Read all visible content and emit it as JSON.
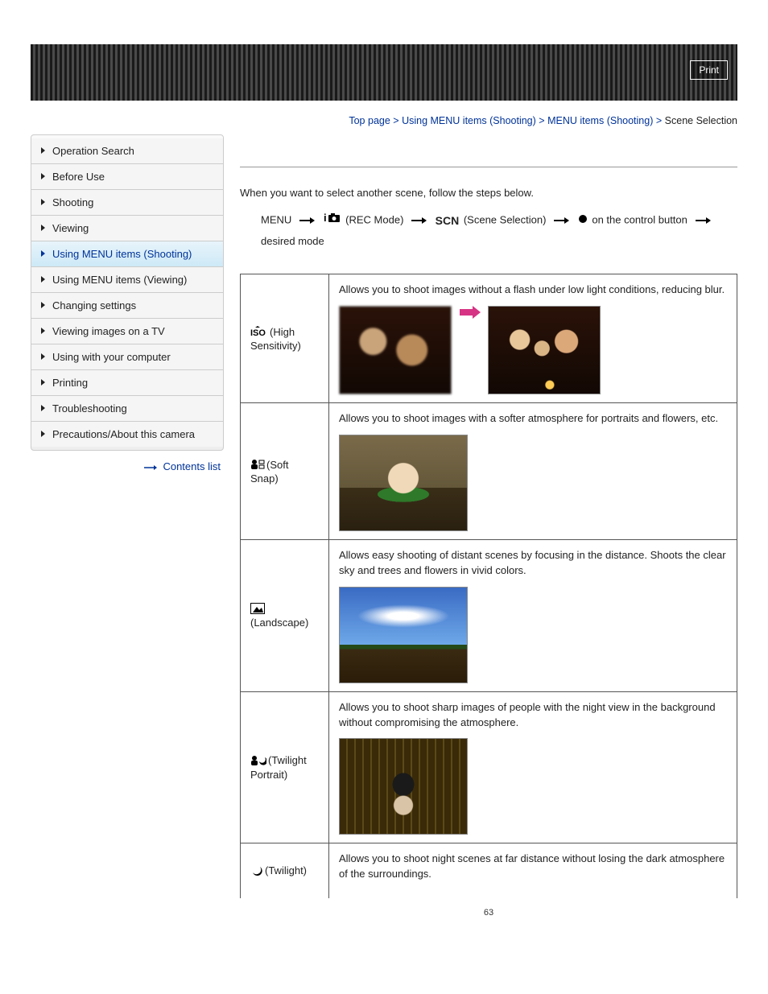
{
  "print_label": "Print",
  "breadcrumb": {
    "top": "Top page",
    "l1": "Using MENU items (Shooting)",
    "l2": "MENU items (Shooting)",
    "current": "Scene Selection",
    "sep": ">"
  },
  "sidebar": {
    "items": [
      {
        "label": "Operation Search"
      },
      {
        "label": "Before Use"
      },
      {
        "label": "Shooting"
      },
      {
        "label": "Viewing"
      },
      {
        "label": "Using MENU items (Shooting)",
        "active": true
      },
      {
        "label": "Using MENU items (Viewing)"
      },
      {
        "label": "Changing settings"
      },
      {
        "label": "Viewing images on a TV"
      },
      {
        "label": "Using with your computer"
      },
      {
        "label": "Printing"
      },
      {
        "label": "Troubleshooting"
      },
      {
        "label": "Precautions/About this camera"
      }
    ],
    "contents_link": "Contents list"
  },
  "intro": "When you want to select another scene, follow the steps below.",
  "steps": {
    "menu": "MENU",
    "rec_mode": "(REC Mode)",
    "scene_sel": "(Scene Selection)",
    "ctrl_btn": "on the control button",
    "desired": "desired mode",
    "scn_text": "SCN"
  },
  "rows": [
    {
      "name": "(High Sensitivity)",
      "icon": "iso-icon",
      "desc": "Allows you to shoot images without a flash under low light conditions, reducing blur."
    },
    {
      "name": "(Soft Snap)",
      "icon": "softsnap-icon",
      "desc": "Allows you to shoot images with a softer atmosphere for portraits and flowers, etc."
    },
    {
      "name": "(Landscape)",
      "icon": "landscape-icon",
      "desc": "Allows easy shooting of distant scenes by focusing in the distance. Shoots the clear sky and trees and flowers in vivid colors."
    },
    {
      "name": "(Twilight Portrait)",
      "icon": "twilight-portrait-icon",
      "desc": "Allows you to shoot sharp images of people with the night view in the background without compromising the atmosphere."
    },
    {
      "name": "(Twilight)",
      "icon": "twilight-icon",
      "desc": "Allows you to shoot night scenes at far distance without losing the dark atmosphere of the surroundings."
    }
  ],
  "page_number": "63"
}
